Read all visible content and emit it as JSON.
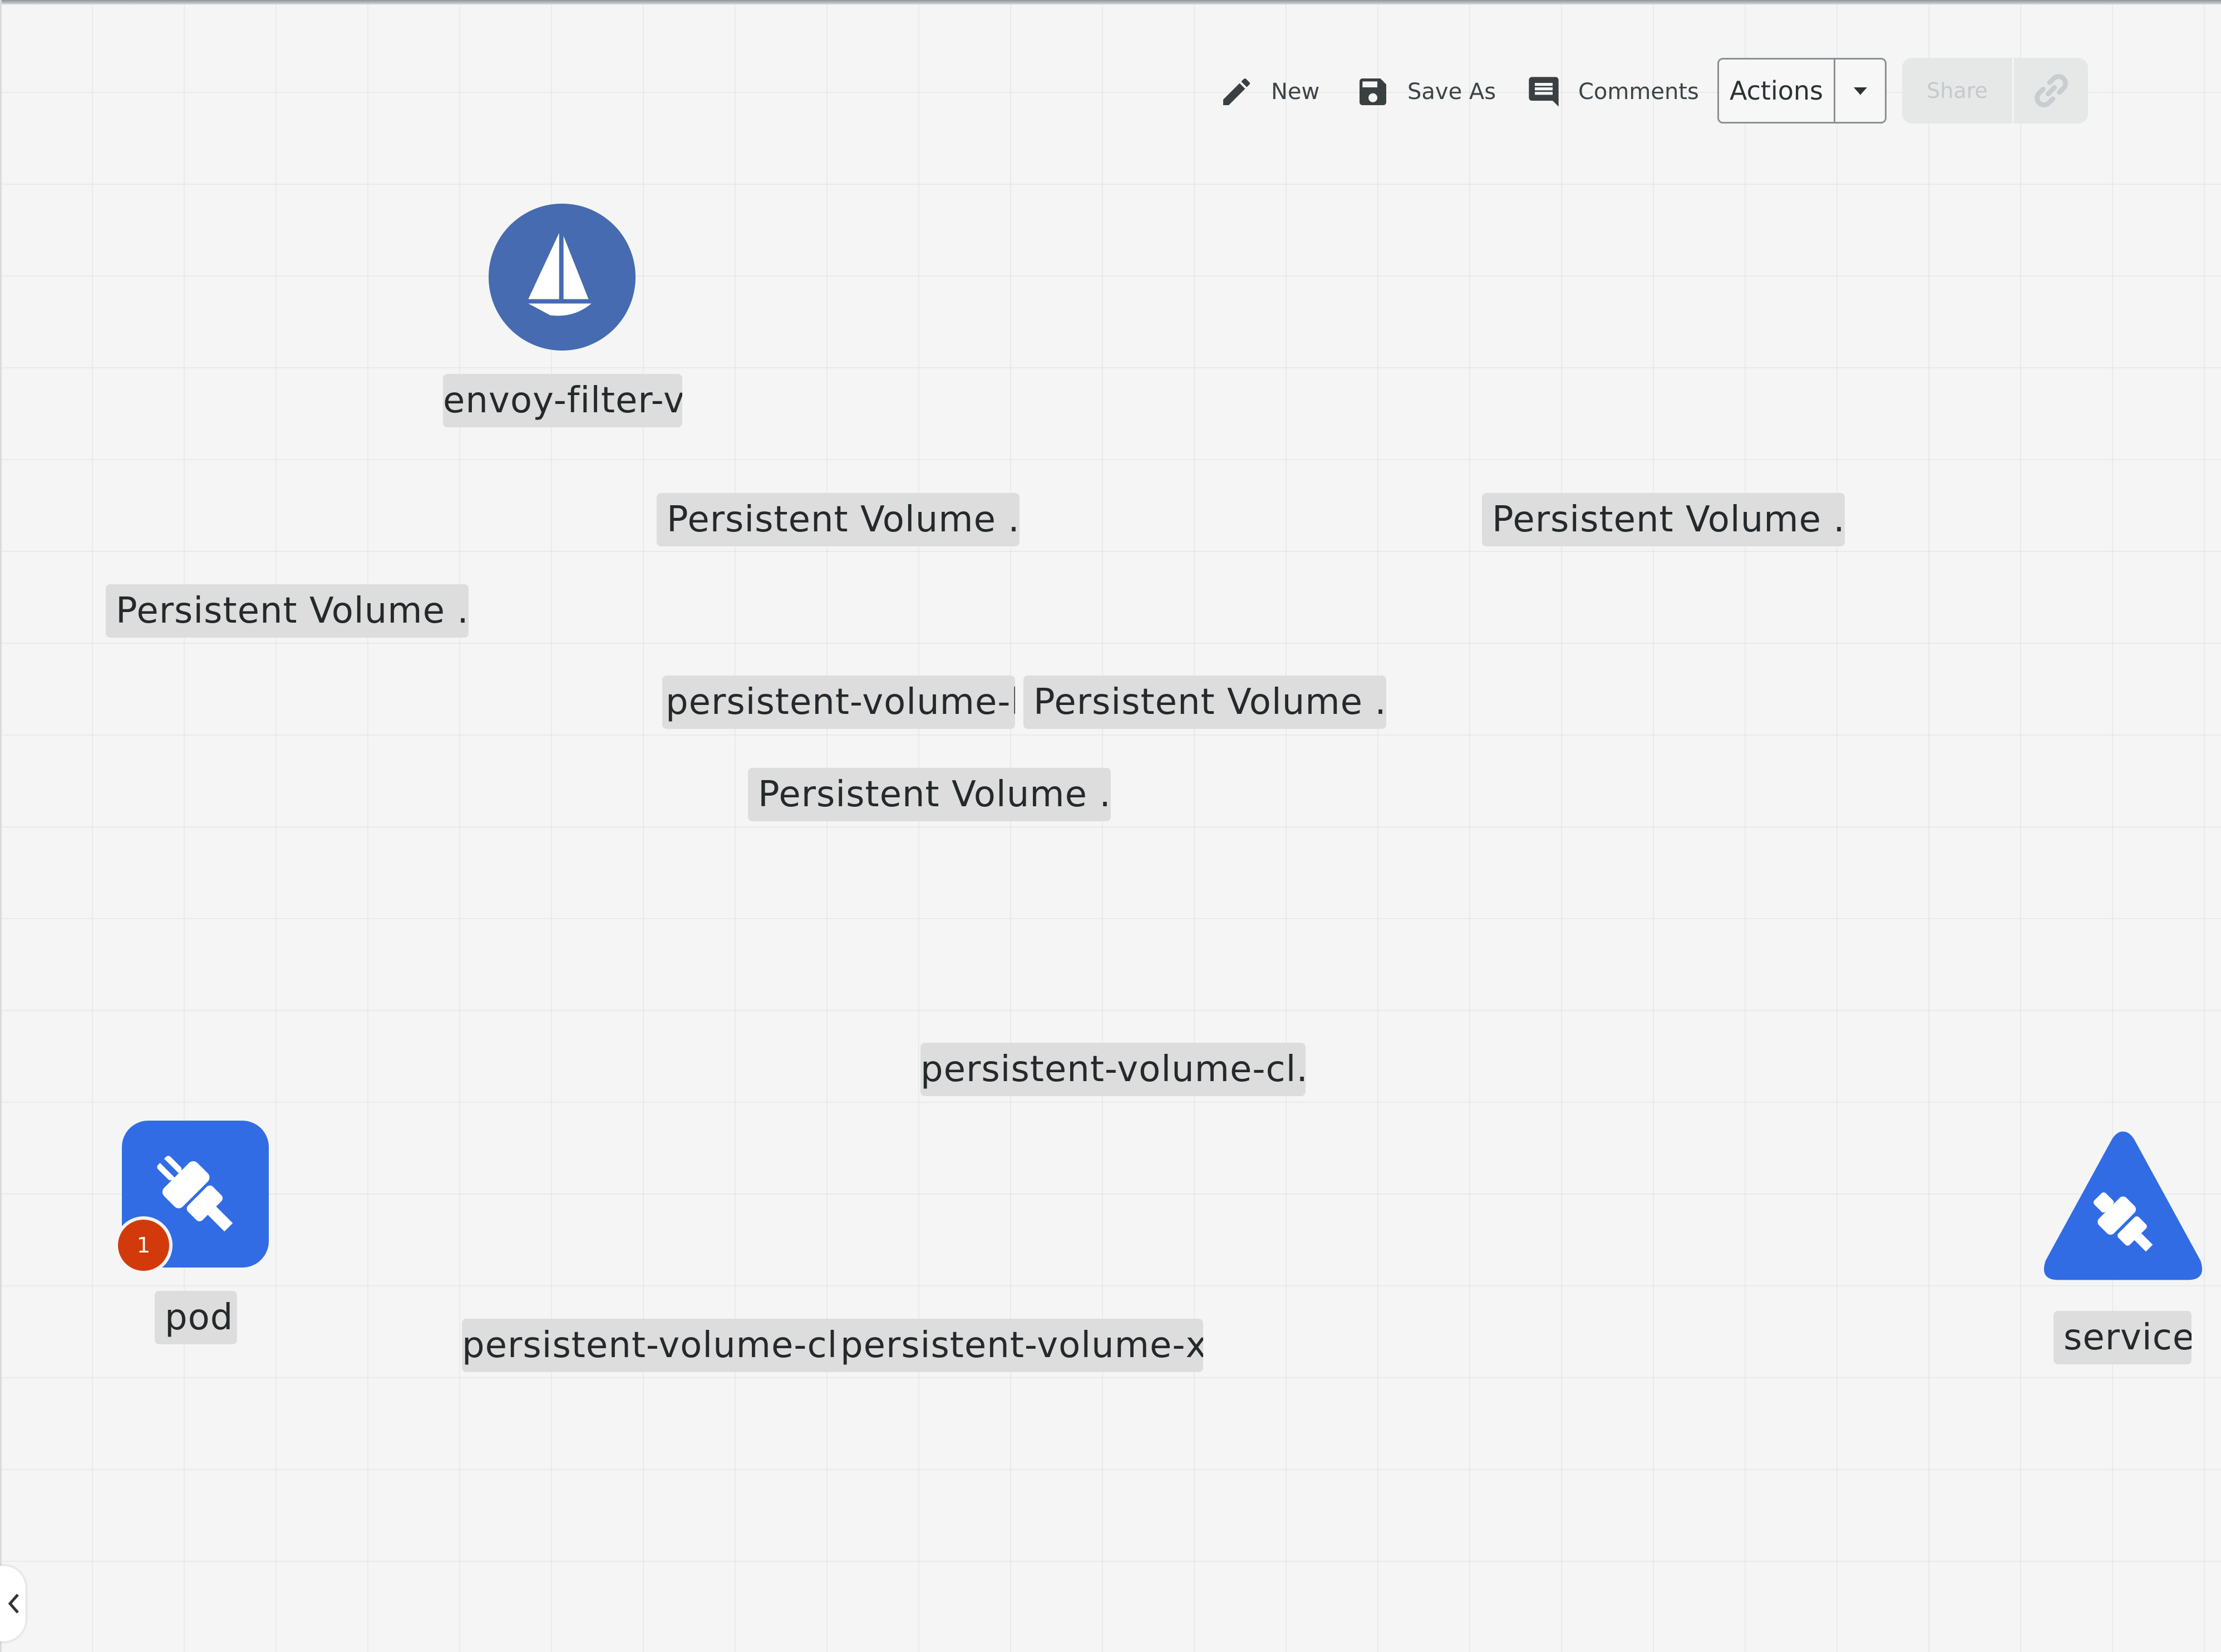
{
  "toolbar": {
    "new_label": "New",
    "new_icon": "pencil-icon",
    "save_as_label": "Save As",
    "save_as_icon": "floppy-disk-icon",
    "comments_label": "Comments",
    "comments_icon": "comment-icon",
    "actions_label": "Actions",
    "actions_icon": "caret-down-icon",
    "share_label": "Share",
    "share_link_icon": "link-icon"
  },
  "canvas": {
    "nodes": {
      "istio": {
        "label": "envoy-filter-vi",
        "icon": "istio-sailboat-icon",
        "color": "#466bb0"
      },
      "pod": {
        "label": "pod",
        "icon": "plug-icon",
        "color": "#326ce5",
        "badge": "1",
        "badge_color": "#d33a0b"
      },
      "service": {
        "label": "service",
        "icon": "plug-icon",
        "color": "#326ce5"
      }
    },
    "labels": {
      "pv_1": "Persistent Volume ...",
      "pv_2": "Persistent Volume ...",
      "pv_3": "Persistent Volume ...",
      "pv_4": "Persistent Volume ...",
      "pv_5": "Persistent Volume ...",
      "pv_ls": "persistent-volume-ls",
      "pvc_1": "persistent-volume-cl...",
      "pvc_2": "persistent-volume-cl...",
      "pv_xn": "persistent-volume-xn"
    }
  },
  "sidebar": {
    "collapse_icon": "chevron-left-icon"
  }
}
